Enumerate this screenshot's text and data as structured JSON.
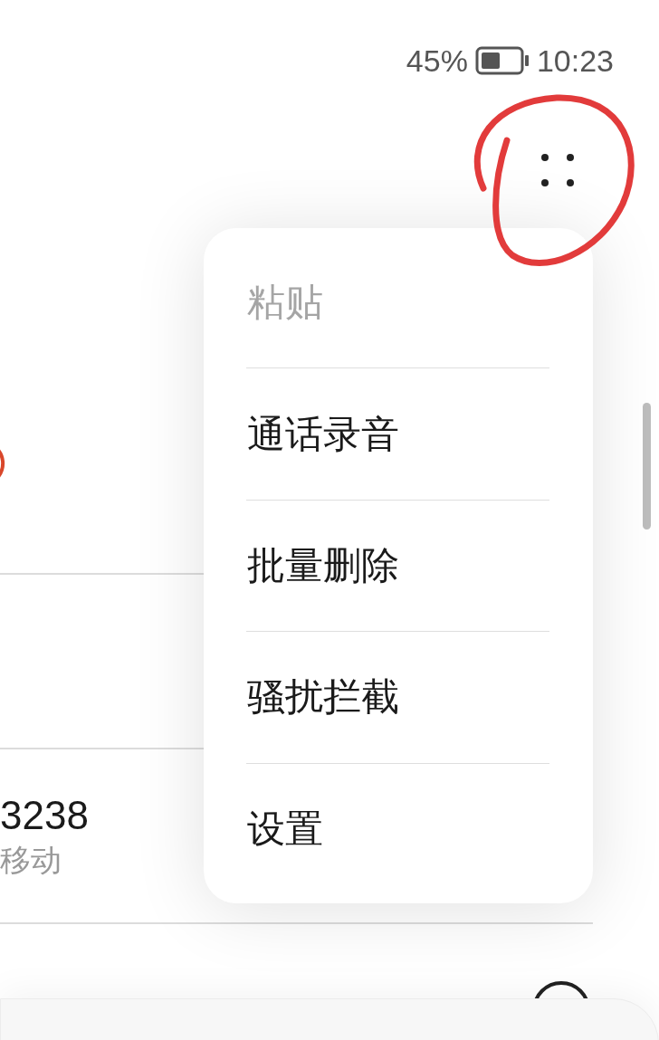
{
  "status_bar": {
    "battery": "45%",
    "time": "10:23"
  },
  "call_log": {
    "rows": [
      {
        "kind": "badge"
      },
      {
        "kind": "blank"
      },
      {
        "kind": "number",
        "number": "3238",
        "location": "移动"
      },
      {
        "kind": "icon"
      }
    ]
  },
  "menu": {
    "items": [
      {
        "label": "粘贴",
        "disabled": true
      },
      {
        "label": "通话录音",
        "disabled": false
      },
      {
        "label": "批量删除",
        "disabled": false
      },
      {
        "label": "骚扰拦截",
        "disabled": false
      },
      {
        "label": "设置",
        "disabled": false
      }
    ]
  }
}
